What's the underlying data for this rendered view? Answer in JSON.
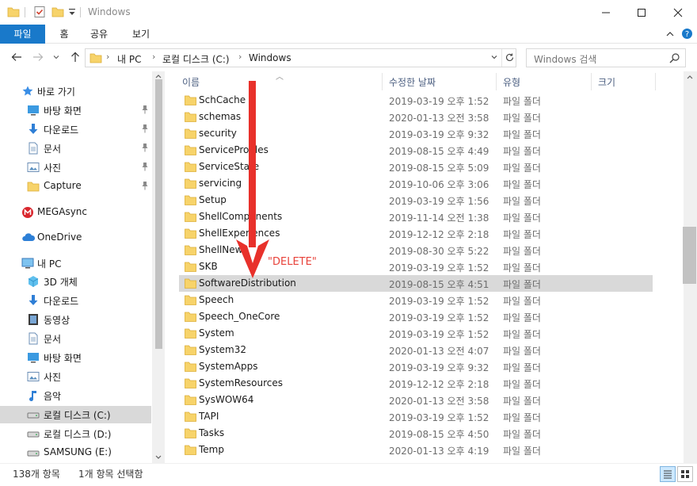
{
  "window": {
    "title": "Windows",
    "accent": "#1979ca"
  },
  "ribbon": {
    "tabs": [
      "파일",
      "홈",
      "공유",
      "보기"
    ]
  },
  "address": {
    "crumbs": [
      "내 PC",
      "로컬 디스크 (C:)",
      "Windows"
    ],
    "search_placeholder": "Windows 검색"
  },
  "nav": {
    "items": [
      {
        "label": "바로 가기",
        "icon": "star-icon",
        "pinned": false
      },
      {
        "label": "바탕 화면",
        "icon": "desktop-icon",
        "pinned": true
      },
      {
        "label": "다운로드",
        "icon": "download-icon",
        "pinned": true
      },
      {
        "label": "문서",
        "icon": "document-icon",
        "pinned": true
      },
      {
        "label": "사진",
        "icon": "pictures-icon",
        "pinned": true
      },
      {
        "label": "Capture",
        "icon": "folder-icon",
        "pinned": true
      },
      {
        "label": "MEGAsync",
        "icon": "mega-icon",
        "pinned": false
      },
      {
        "label": "OneDrive",
        "icon": "cloud-icon",
        "pinned": false
      },
      {
        "label": "내 PC",
        "icon": "pc-icon",
        "pinned": false
      },
      {
        "label": "3D 개체",
        "icon": "cube-icon",
        "pinned": false
      },
      {
        "label": "다운로드",
        "icon": "download-icon",
        "pinned": false
      },
      {
        "label": "동영상",
        "icon": "video-icon",
        "pinned": false
      },
      {
        "label": "문서",
        "icon": "document-icon",
        "pinned": false
      },
      {
        "label": "바탕 화면",
        "icon": "desktop-icon",
        "pinned": false
      },
      {
        "label": "사진",
        "icon": "pictures-icon",
        "pinned": false
      },
      {
        "label": "음악",
        "icon": "music-icon",
        "pinned": false
      },
      {
        "label": "로컬 디스크 (C:)",
        "icon": "drive-icon",
        "pinned": false,
        "selected": true
      },
      {
        "label": "로컬 디스크 (D:)",
        "icon": "drive-icon",
        "pinned": false
      },
      {
        "label": "SAMSUNG (E:)",
        "icon": "drive-icon",
        "pinned": false
      }
    ]
  },
  "columns": {
    "name": "이름",
    "date": "수정한 날짜",
    "type": "유형",
    "size": "크기"
  },
  "files": [
    {
      "name": "SchCache",
      "date": "2019-03-19 오후 1:52",
      "type": "파일 폴더"
    },
    {
      "name": "schemas",
      "date": "2020-01-13 오전 3:58",
      "type": "파일 폴더"
    },
    {
      "name": "security",
      "date": "2019-03-19 오후 9:32",
      "type": "파일 폴더"
    },
    {
      "name": "ServiceProfiles",
      "date": "2019-08-15 오후 4:49",
      "type": "파일 폴더"
    },
    {
      "name": "ServiceState",
      "date": "2019-08-15 오후 5:09",
      "type": "파일 폴더"
    },
    {
      "name": "servicing",
      "date": "2019-10-06 오후 3:06",
      "type": "파일 폴더"
    },
    {
      "name": "Setup",
      "date": "2019-03-19 오후 1:56",
      "type": "파일 폴더"
    },
    {
      "name": "ShellComponents",
      "date": "2019-11-14 오전 1:38",
      "type": "파일 폴더"
    },
    {
      "name": "ShellExperiences",
      "date": "2019-12-12 오후 2:18",
      "type": "파일 폴더"
    },
    {
      "name": "ShellNew",
      "date": "2019-08-30 오후 5:22",
      "type": "파일 폴더"
    },
    {
      "name": "SKB",
      "date": "2019-03-19 오후 1:52",
      "type": "파일 폴더"
    },
    {
      "name": "SoftwareDistribution",
      "date": "2019-08-15 오후 4:51",
      "type": "파일 폴더",
      "selected": true
    },
    {
      "name": "Speech",
      "date": "2019-03-19 오후 1:52",
      "type": "파일 폴더"
    },
    {
      "name": "Speech_OneCore",
      "date": "2019-03-19 오후 1:52",
      "type": "파일 폴더"
    },
    {
      "name": "System",
      "date": "2019-03-19 오후 1:52",
      "type": "파일 폴더"
    },
    {
      "name": "System32",
      "date": "2020-01-13 오전 4:07",
      "type": "파일 폴더"
    },
    {
      "name": "SystemApps",
      "date": "2019-03-19 오후 9:32",
      "type": "파일 폴더"
    },
    {
      "name": "SystemResources",
      "date": "2019-12-12 오후 2:18",
      "type": "파일 폴더"
    },
    {
      "name": "SysWOW64",
      "date": "2020-01-13 오전 3:58",
      "type": "파일 폴더"
    },
    {
      "name": "TAPI",
      "date": "2019-03-19 오후 1:52",
      "type": "파일 폴더"
    },
    {
      "name": "Tasks",
      "date": "2019-08-15 오후 4:50",
      "type": "파일 폴더"
    },
    {
      "name": "Temp",
      "date": "2020-01-13 오후 4:19",
      "type": "파일 폴더"
    }
  ],
  "annotation": {
    "text": "\"DELETE\"",
    "color": "#e8423a"
  },
  "status": {
    "count": "138개 항목",
    "selection": "1개 항목 선택함"
  }
}
